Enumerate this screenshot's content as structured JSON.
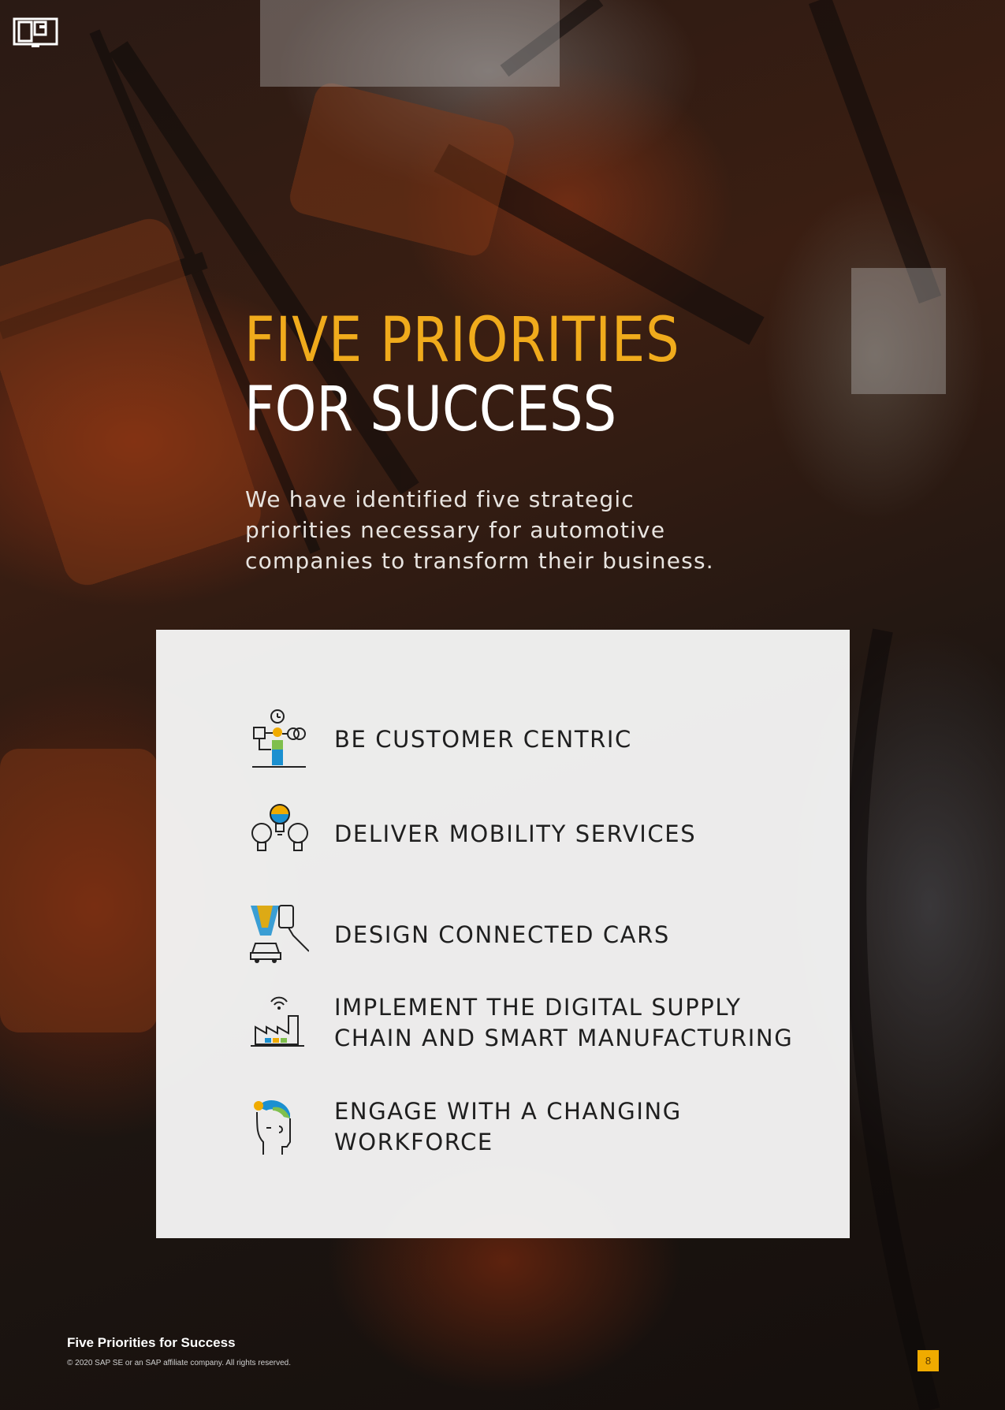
{
  "header": {
    "title_line1": "FIVE PRIORITIES",
    "title_line2": "FOR SUCCESS",
    "intro": "We have identified five strategic priorities necessary for automotive companies to transform their business."
  },
  "priorities": [
    {
      "label_line1": "BE CUSTOMER CENTRIC",
      "label_line2": "",
      "icon": "customer-centric-icon"
    },
    {
      "label_line1": "DELIVER MOBILITY SERVICES",
      "label_line2": "",
      "icon": "lightbulbs-icon"
    },
    {
      "label_line1": "DESIGN CONNECTED CARS",
      "label_line2": "",
      "icon": "connected-car-icon"
    },
    {
      "label_line1": "IMPLEMENT THE DIGITAL SUPPLY",
      "label_line2": "CHAIN AND SMART MANUFACTURING",
      "icon": "factory-icon"
    },
    {
      "label_line1": "ENGAGE WITH A CHANGING",
      "label_line2": "WORKFORCE",
      "icon": "worker-head-icon"
    }
  ],
  "footer": {
    "title": "Five Priorities for Success",
    "copyright": "© 2020 SAP SE or an SAP affiliate company. All rights reserved.",
    "page_number": "8"
  },
  "colors": {
    "accent": "#f0ab1c",
    "panel": "#f5f5f5",
    "text_dark": "#1f1f1f"
  }
}
